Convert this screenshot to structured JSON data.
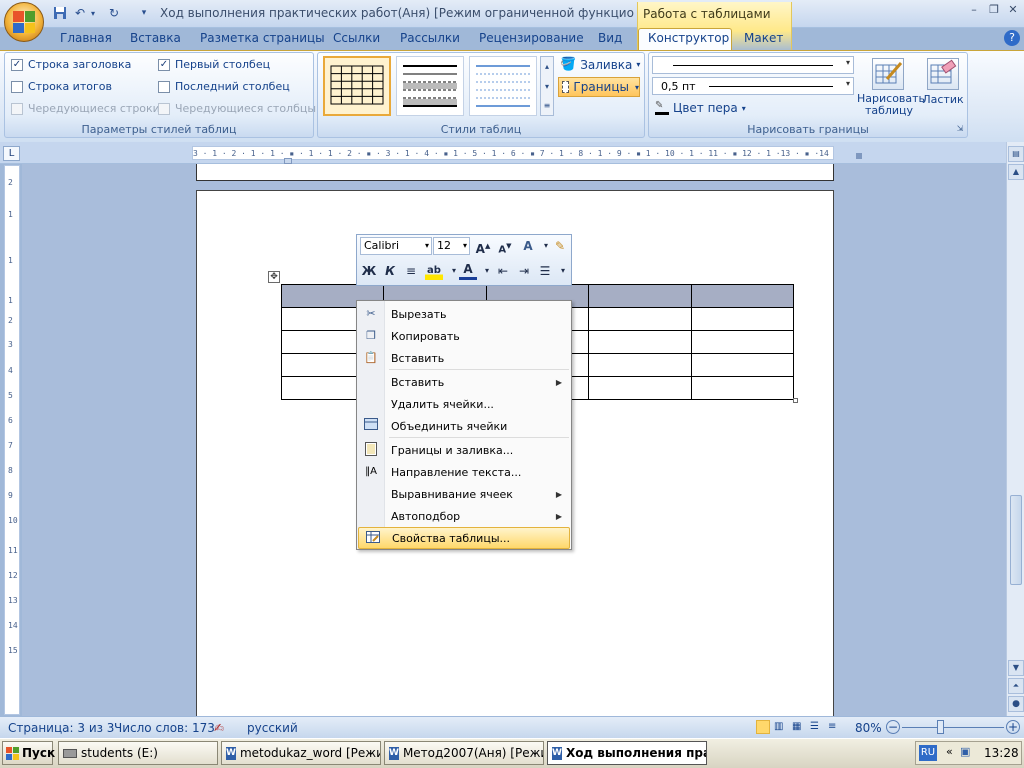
{
  "window": {
    "title": "Ход выполнения практических работ(Аня) [Режим ограниченной функциональности] М",
    "context_tab_title": "Работа с таблицами",
    "controls": [
      "–",
      "❐",
      "✕"
    ]
  },
  "tabs": [
    "Главная",
    "Вставка",
    "Разметка страницы",
    "Ссылки",
    "Рассылки",
    "Рецензирование",
    "Вид",
    "Конструктор",
    "Макет"
  ],
  "active_tab": "Конструктор",
  "ribbon": {
    "table_style_options": {
      "label": "Параметры стилей таблиц",
      "items": [
        {
          "label": "Строка заголовка",
          "checked": true,
          "enabled": true
        },
        {
          "label": "Первый столбец",
          "checked": true,
          "enabled": true
        },
        {
          "label": "Строка итогов",
          "checked": false,
          "enabled": true
        },
        {
          "label": "Последний столбец",
          "checked": false,
          "enabled": true
        },
        {
          "label": "Чередующиеся строки",
          "checked": false,
          "enabled": false
        },
        {
          "label": "Чередующиеся столбцы",
          "checked": false,
          "enabled": false
        }
      ]
    },
    "table_styles": {
      "label": "Стили таблиц",
      "shading": "Заливка",
      "borders": "Границы"
    },
    "draw_borders": {
      "label": "Нарисовать границы",
      "line_weight": "0,5 пт",
      "pen_color": "Цвет пера",
      "draw_table": "Нарисовать таблицу",
      "eraser": "Ластик"
    }
  },
  "ruler": {
    "horizontal": "3 · 1 · 2 · 1 · 1 · ▪ · 1 · 1 · 2 · ▪ · 3 · 1 · 4 · ▪ 1 · 5 · 1 · 6 · ▪ 7 · 1 · 8 · 1 · 9 · ▪ 1 · 10 · 1 · 11 · ▪ 12 · 1 ·13 · ▪ ·14 · 1 ·15 · 1 ·16 · ▪17 · 1 ·",
    "vertical_ticks": [
      "2",
      "1",
      "1",
      "1",
      "2",
      "3",
      "4",
      "5",
      "6",
      "7",
      "8",
      "9",
      "10",
      "11",
      "12",
      "13",
      "14",
      "15"
    ]
  },
  "mini_toolbar": {
    "font": "Calibri",
    "size": "12",
    "bold": "Ж",
    "italic": "К"
  },
  "context_menu": {
    "items": [
      {
        "label": "Вырезать",
        "icon": "scissors-icon",
        "submenu": false
      },
      {
        "label": "Копировать",
        "icon": "copy-icon",
        "submenu": false
      },
      {
        "label": "Вставить",
        "icon": "paste-icon",
        "submenu": false
      },
      {
        "label": "Вставить",
        "icon": "",
        "submenu": true
      },
      {
        "label": "Удалить ячейки...",
        "icon": "",
        "submenu": false
      },
      {
        "label": "Объединить ячейки",
        "icon": "merge-cells-icon",
        "submenu": false
      },
      {
        "label": "Границы и заливка...",
        "icon": "borders-shading-icon",
        "submenu": false
      },
      {
        "label": "Направление текста...",
        "icon": "text-direction-icon",
        "submenu": false
      },
      {
        "label": "Выравнивание ячеек",
        "icon": "",
        "submenu": true
      },
      {
        "label": "Автоподбор",
        "icon": "",
        "submenu": true
      },
      {
        "label": "Свойства таблицы...",
        "icon": "table-properties-icon",
        "submenu": false,
        "highlighted": true
      }
    ]
  },
  "table": {
    "rows": 5,
    "cols": 5,
    "header_color": "#a6aec4"
  },
  "status": {
    "page": "Страница: 3 из 3",
    "words": "Число слов: 173",
    "language": "русский",
    "zoom": "80%"
  },
  "taskbar": {
    "start": "Пуск",
    "tasks": [
      {
        "label": "students (E:)",
        "active": false
      },
      {
        "label": "metodukaz_word [Режи...",
        "active": false
      },
      {
        "label": "Метод2007(Аня) [Режи...",
        "active": false
      },
      {
        "label": "Ход выполнения пра...",
        "active": true
      }
    ],
    "lang": "RU",
    "time": "13:28"
  },
  "colors": {
    "accent": "#15428b",
    "ribbon_bg": "#dde8f6",
    "context_highlight": "#ffd86b",
    "workspace": "#a9bddb"
  }
}
